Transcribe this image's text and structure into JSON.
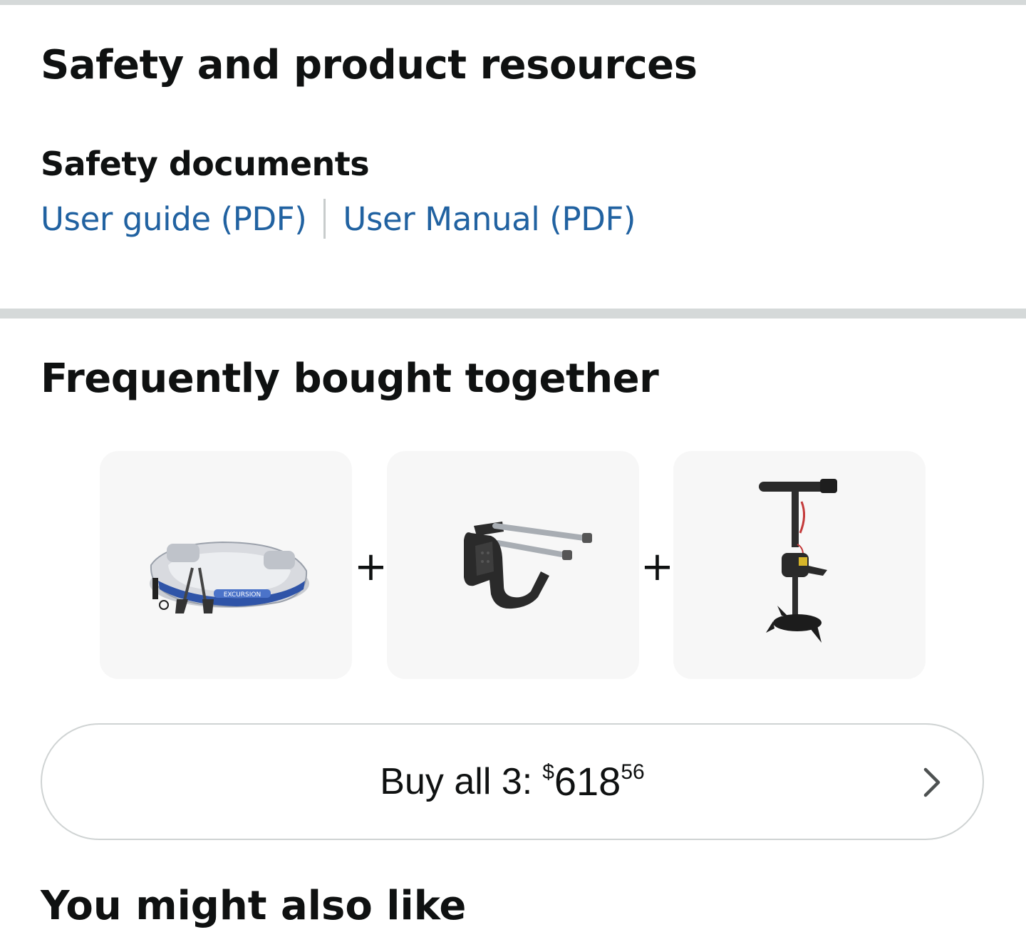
{
  "safety_section": {
    "heading": "Safety and product resources",
    "subheading": "Safety documents",
    "links": [
      "User guide (PDF)",
      "User Manual (PDF)"
    ]
  },
  "fbt_section": {
    "heading": "Frequently bought together",
    "products": [
      {
        "image": "inflatable-boat-image"
      },
      {
        "image": "motor-mount-image"
      },
      {
        "image": "trolling-motor-image"
      }
    ],
    "plus_sign": "+",
    "buy_all": {
      "label": "Buy all 3:",
      "currency": "$",
      "price_whole": "618",
      "price_fraction": "56",
      "chevron_icon": "chevron-right-icon"
    }
  },
  "next_section": {
    "heading": "You might also like"
  },
  "colors": {
    "link": "#2162a1",
    "divider": "#d5d9d9",
    "tile_bg": "#f7f7f7",
    "text": "#0f1111"
  }
}
